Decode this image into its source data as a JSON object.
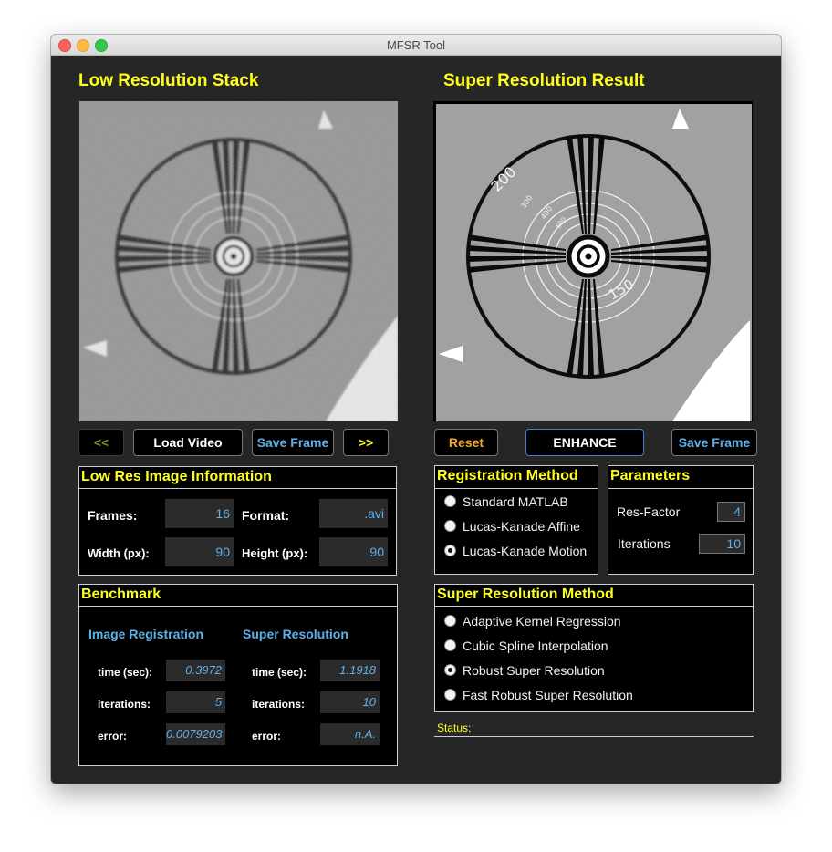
{
  "window": {
    "title": "MFSR Tool"
  },
  "left": {
    "heading": "Low Resolution Stack",
    "buttons": {
      "prev": "<<",
      "load": "Load Video",
      "save": "Save Frame",
      "next": ">>"
    },
    "info": {
      "title": "Low Res Image Information",
      "frames_label": "Frames:",
      "frames_value": "16",
      "format_label": "Format:",
      "format_value": ".avi",
      "width_label": "Width (px):",
      "width_value": "90",
      "height_label": "Height (px):",
      "height_value": "90"
    },
    "benchmark": {
      "title": "Benchmark",
      "reg_title": "Image Registration",
      "sr_title": "Super Resolution",
      "time_label": "time (sec):",
      "iter_label": "iterations:",
      "error_label": "error:",
      "reg": {
        "time": "0.3972",
        "iterations": "5",
        "error": "0.0079203"
      },
      "sr": {
        "time": "1.1918",
        "iterations": "10",
        "error": "n.A."
      }
    }
  },
  "right": {
    "heading": "Super Resolution Result",
    "buttons": {
      "reset": "Reset",
      "enhance": "ENHANCE",
      "save": "Save Frame"
    },
    "registration": {
      "title": "Registration Method",
      "options": [
        "Standard MATLAB",
        "Lucas-Kanade Affine",
        "Lucas-Kanade Motion"
      ],
      "selected": 2
    },
    "parameters": {
      "title": "Parameters",
      "res_label": "Res-Factor",
      "res_value": "4",
      "iter_label": "Iterations",
      "iter_value": "10"
    },
    "sr_method": {
      "title": "Super Resolution Method",
      "options": [
        "Adaptive Kernel Regression",
        "Cubic Spline Interpolation",
        "Robust Super Resolution",
        "Fast Robust Super Resolution"
      ],
      "selected": 2
    },
    "status_label": "Status:"
  },
  "image_labels": {
    "r200": "200",
    "r150": "150",
    "r300": "300",
    "r400": "400",
    "r500": "500"
  },
  "colors": {
    "heading": "#ffff1e",
    "value": "#5fb0e8",
    "prev_btn": "#8e8e22",
    "reset_btn": "#f5a623",
    "save_btn": "#5fb0e8",
    "next_btn": "#ffff1e",
    "enhance_border": "#3d82d6"
  }
}
